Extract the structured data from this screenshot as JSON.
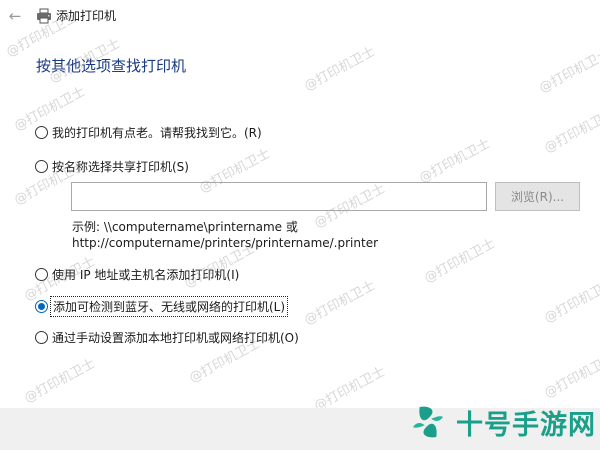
{
  "window": {
    "title": "添加打印机",
    "back_icon": "back-arrow-icon",
    "printer_icon": "printer-icon"
  },
  "heading": "按其他选项查找打印机",
  "options": [
    {
      "label": "我的打印机有点老。请帮我找到它。(R)",
      "checked": false
    },
    {
      "label": "按名称选择共享打印机(S)",
      "checked": false
    },
    {
      "label": "使用 IP 地址或主机名添加打印机(I)",
      "checked": false
    },
    {
      "label": "添加可检测到蓝牙、无线或网络的打印机(L)",
      "checked": true
    },
    {
      "label": "通过手动设置添加本地打印机或网络打印机(O)",
      "checked": false
    }
  ],
  "shared_printer": {
    "input_value": "",
    "browse_label": "浏览(R)...",
    "example_line1": "示例: \\\\computername\\printername 或",
    "example_line2": "http://computername/printers/printername/.printer"
  },
  "watermark": "@打印机卫士",
  "logo": {
    "text": "十号手游网",
    "color": "#1aa08a"
  },
  "colors": {
    "heading": "#1a3a86",
    "radio_selected": "#0067c0",
    "bottom_bar": "#f0f0f0"
  }
}
